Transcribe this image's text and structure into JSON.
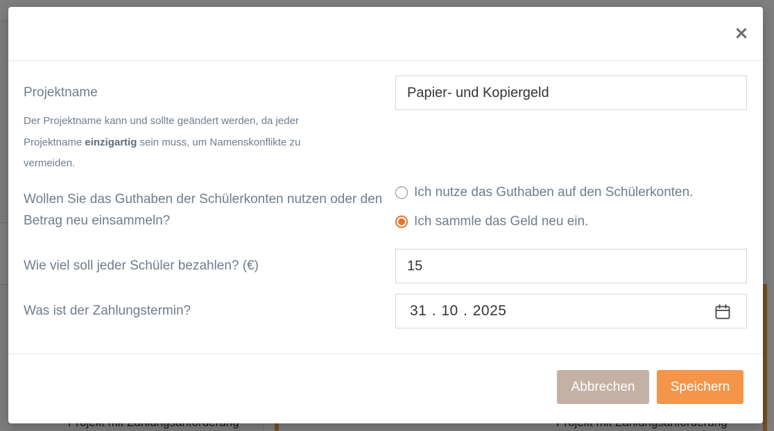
{
  "modal": {
    "close_symbol": "×",
    "project_name": {
      "label": "Projektname",
      "help_before": "Der Projektname kann und sollte geändert werden, da jeder Projektname ",
      "help_bold": "einzigartig",
      "help_after": " sein muss, um Namenskonflikte zu vermeiden.",
      "value": "Papier- und Kopiergeld"
    },
    "funding": {
      "question": "Wollen Sie das Guthaben der Schülerkonten nutzen oder den Betrag neu einsammeln?",
      "options": [
        {
          "label": "Ich nutze das Guthaben auf den Schülerkonten.",
          "checked": false
        },
        {
          "label": "Ich sammle das Geld neu ein.",
          "checked": true
        }
      ]
    },
    "amount": {
      "label": "Wie viel soll jeder Schüler bezahlen? (€)",
      "value": "15"
    },
    "due_date": {
      "label": "Was ist der Zahlungstermin?",
      "value": "31 . 10 . 2025",
      "icon": "calendar-icon"
    },
    "buttons": {
      "cancel": "Abbrechen",
      "save": "Speichern"
    }
  },
  "background": {
    "card_footer_left": "Projekt mit Zahlungsanforderung",
    "card_footer_right": "Projekt mit Zahlungsanforderung"
  },
  "colors": {
    "accent": "#f4954a",
    "radio_checked": "#e0762f",
    "cancel": "#c4b1a5",
    "label_text": "#6e7d8c"
  }
}
